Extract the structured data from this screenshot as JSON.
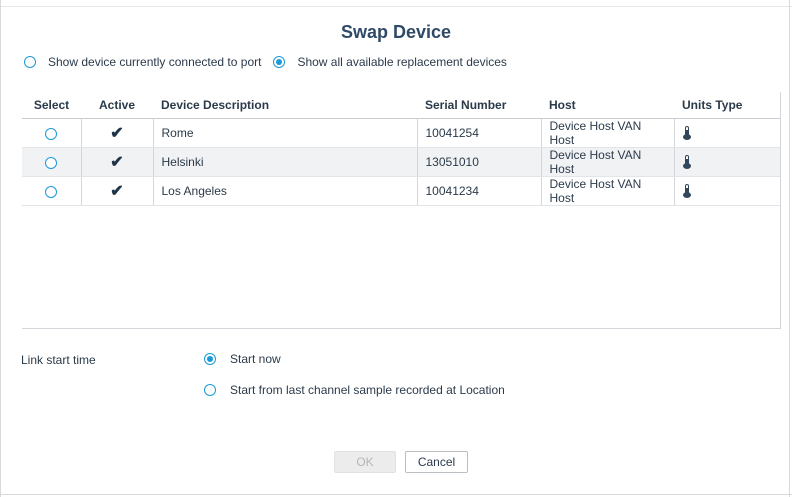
{
  "dialog": {
    "title": "Swap Device"
  },
  "mode": {
    "option_connected": "Show device currently connected to port",
    "option_all": "Show all available replacement devices",
    "selected": "all"
  },
  "table": {
    "headers": [
      "Select",
      "Active",
      "Device Description",
      "Serial Number",
      "Host",
      "Units Type"
    ],
    "rows": [
      {
        "description": "Rome",
        "serial": "10041254",
        "host": "Device Host VAN Host",
        "active": true,
        "units_icon": "thermometer-icon"
      },
      {
        "description": "Helsinki",
        "serial": "13051010",
        "host": "Device Host VAN Host",
        "active": true,
        "units_icon": "thermometer-icon"
      },
      {
        "description": "Los Angeles",
        "serial": "10041234",
        "host": "Device Host VAN Host",
        "active": true,
        "units_icon": "thermometer-icon"
      }
    ]
  },
  "link_start": {
    "label": "Link start time",
    "option_now": "Start now",
    "option_last_sample": "Start from last channel sample recorded at Location",
    "selected": "now"
  },
  "buttons": {
    "ok": "OK",
    "cancel": "Cancel"
  },
  "colors": {
    "accent": "#1a9ad6",
    "title": "#2f4a66",
    "text": "#2b3a4a"
  }
}
